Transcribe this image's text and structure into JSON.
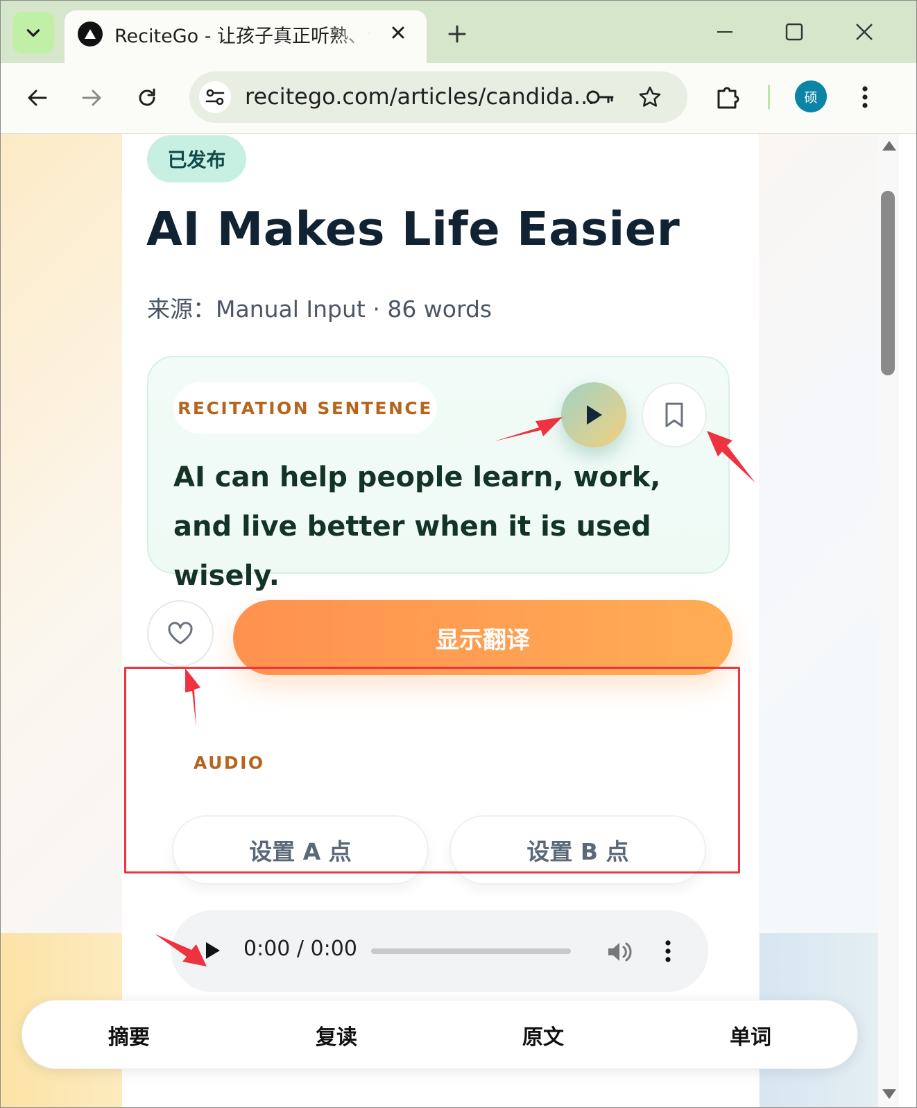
{
  "browser": {
    "tab_title": "ReciteGo - 让孩子真正听熟、读熟",
    "url": "recitego.com/articles/candida...",
    "profile_initial": "硕",
    "icons": [
      "tab-search-icon",
      "app-favicon-icon",
      "close-icon",
      "plus-icon",
      "minimize-icon",
      "maximize-icon",
      "window-close-icon",
      "back-icon",
      "forward-icon",
      "reload-icon",
      "site-settings-icon",
      "key-icon",
      "star-icon",
      "extensions-icon",
      "more-vert-icon"
    ]
  },
  "article": {
    "status_badge": "已发布",
    "title": "AI Makes Life Easier",
    "meta": "来源：Manual Input · 86 words"
  },
  "recitation": {
    "section_label": "RECITATION SENTENCE",
    "sentence": "AI can help people learn, work, and live better when it is used wisely.",
    "icons": [
      "play-icon",
      "bookmark-icon"
    ]
  },
  "actions": {
    "translate_label": "显示翻译",
    "icons": [
      "heart-icon"
    ]
  },
  "audio": {
    "section_label": "AUDIO",
    "set_a_label": "设置 A 点",
    "set_b_label": "设置 B 点",
    "time_display": "0:00 / 0:00",
    "progress": 0
  },
  "bottom_nav": {
    "items": [
      "摘要",
      "复读",
      "原文",
      "单词"
    ]
  },
  "colors": {
    "accent_orange": "#ff9f52",
    "section_label": "#b5651d",
    "badge_bg": "#c8f0e2",
    "annotation_red": "#ee3340",
    "tab_strip": "#d5e6cb"
  }
}
